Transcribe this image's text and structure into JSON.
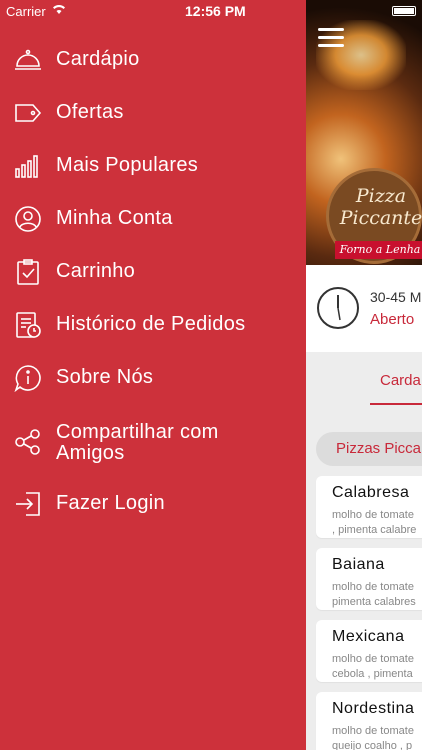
{
  "status_bar": {
    "carrier": "Carrier",
    "time": "12:56 PM"
  },
  "drawer": {
    "items": [
      {
        "label": "Cardápio",
        "icon": "cloche-icon"
      },
      {
        "label": "Ofertas",
        "icon": "tag-icon"
      },
      {
        "label": "Mais Populares",
        "icon": "bar-chart-icon"
      },
      {
        "label": "Minha Conta",
        "icon": "user-icon"
      },
      {
        "label": "Carrinho",
        "icon": "cart-icon"
      },
      {
        "label": "Histórico de Pedidos",
        "icon": "history-icon"
      },
      {
        "label": "Sobre Nós",
        "icon": "info-icon"
      },
      {
        "label": "Compartilhar com Amigos",
        "icon": "share-icon"
      },
      {
        "label": "Fazer Login",
        "icon": "login-icon"
      }
    ]
  },
  "restaurant": {
    "logo_line1": "Pizza",
    "logo_line2": "Piccante",
    "logo_ribbon": "Forno a Lenha",
    "delivery_time": "30-45 M",
    "open_status": "Aberto"
  },
  "tabs": {
    "active": "Carda"
  },
  "category": "Pizzas Picca",
  "products": [
    {
      "name": "Calabresa",
      "desc1": "molho de tomate",
      "desc2": ", pimenta calabre"
    },
    {
      "name": "Baiana",
      "desc1": "molho de tomate",
      "desc2": "pimenta calabres"
    },
    {
      "name": "Mexicana",
      "desc1": "molho de tomate",
      "desc2": "cebola , pimenta"
    },
    {
      "name": "Nordestina",
      "desc1": "molho de tomate",
      "desc2": "queijo coalho , p"
    }
  ],
  "colors": {
    "drawer_bg": "#cd313b",
    "accent": "#c8293a"
  }
}
